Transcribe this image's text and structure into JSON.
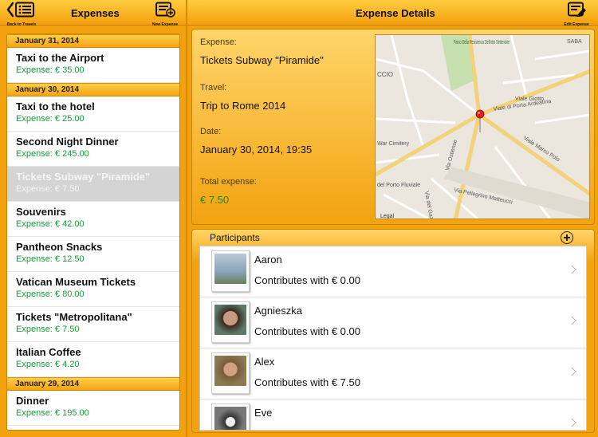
{
  "left_nav": {
    "title": "Expenses",
    "back_label": "Back to Travels",
    "new_label": "New Expense"
  },
  "right_nav": {
    "title": "Expense Details",
    "edit_label": "Edit Expense"
  },
  "sections": [
    {
      "date": "January 31, 2014",
      "items": [
        {
          "title": "Taxi to the Airport",
          "amount": "Expense: € 35.00"
        }
      ]
    },
    {
      "date": "January 30, 2014",
      "items": [
        {
          "title": "Taxi to the hotel",
          "amount": "Expense: € 25.00"
        },
        {
          "title": "Second Night Dinner",
          "amount": "Expense: € 245.00"
        },
        {
          "title": "Tickets Subway \"Piramide\"",
          "amount": "Expense: € 7.50",
          "selected": true
        },
        {
          "title": "Souvenirs",
          "amount": "Expense: € 42.00"
        },
        {
          "title": "Pantheon Snacks",
          "amount": "Expense: € 12.50"
        },
        {
          "title": "Vatican Museum Tickets",
          "amount": "Expense: € 80.00"
        },
        {
          "title": "Tickets \"Metropolitana\"",
          "amount": "Expense: € 7.50"
        },
        {
          "title": "Italian Coffee",
          "amount": "Expense: € 4.20"
        }
      ]
    },
    {
      "date": "January 29, 2014",
      "items": [
        {
          "title": "Dinner",
          "amount": "Expense: € 195.00"
        }
      ]
    }
  ],
  "details": {
    "expense_label": "Expense:",
    "expense_value": "Tickets Subway \"Piramide\"",
    "travel_label": "Travel:",
    "travel_value": "Trip to Rome 2014",
    "date_label": "Date:",
    "date_value": "January 30, 2014, 19:35",
    "total_label": "Total expense:",
    "total_value": "€ 7.50"
  },
  "map": {
    "labels": {
      "park": "Parco Della Resistenza Dell'otto Settembre",
      "saba": "SABA",
      "ccio": "CCIO",
      "giotto": "Viale Giotto",
      "porta": "Viale di Porta Ardeatina",
      "war": "War Cimitery",
      "ostiense": "Via Ostiense",
      "marco": "Viale Marco Polo",
      "fluviale": "del Porto Fluviale",
      "gazometro": "Via del Gazometro",
      "pellegrino": "Via Pellegrino Matteucci",
      "legal": "Legal"
    }
  },
  "participants": {
    "title": "Participants",
    "people": [
      {
        "name": "Aaron",
        "contrib": "Contributes with € 0.00",
        "color": "#8aa4b8"
      },
      {
        "name": "Agnieszka",
        "contrib": "Contributes with € 0.00",
        "color": "#5c7a6a"
      },
      {
        "name": "Alex",
        "contrib": "Contributes with € 7.50",
        "color": "#8a7c52"
      },
      {
        "name": "Eve",
        "contrib": "",
        "color": "#777777"
      }
    ]
  }
}
